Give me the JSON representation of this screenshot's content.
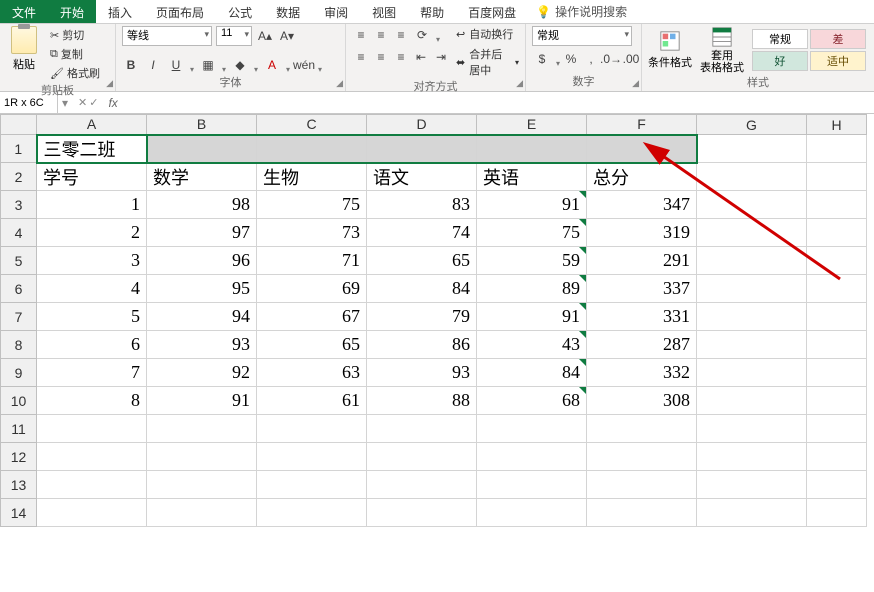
{
  "tabs": {
    "file": "文件",
    "home": "开始",
    "insert": "插入",
    "layout": "页面布局",
    "formulas": "公式",
    "data": "数据",
    "review": "审阅",
    "view": "视图",
    "help": "帮助",
    "baidu": "百度网盘",
    "search": "操作说明搜索"
  },
  "ribbon": {
    "clipboard": {
      "paste": "粘贴",
      "cut": "剪切",
      "copy": "复制",
      "format_painter": "格式刷",
      "label": "剪贴板"
    },
    "font": {
      "name": "等线",
      "size": "11",
      "label": "字体"
    },
    "alignment": {
      "wrap": "自动换行",
      "merge": "合并后居中",
      "label": "对齐方式"
    },
    "number": {
      "format": "常规",
      "label": "数字"
    },
    "styles": {
      "cond": "条件格式",
      "table": "套用\n表格格式",
      "normal": "常规",
      "bad": "差",
      "good": "好",
      "neutral": "适中",
      "label": "样式"
    }
  },
  "fx": {
    "name_box": "1R x 6C",
    "formula": ""
  },
  "columns": [
    "A",
    "B",
    "C",
    "D",
    "E",
    "F",
    "G",
    "H"
  ],
  "sheet": {
    "title": "三零二班",
    "headers": [
      "学号",
      "数学",
      "生物",
      "语文",
      "英语",
      "总分"
    ],
    "rows": [
      [
        1,
        98,
        75,
        83,
        91,
        347
      ],
      [
        2,
        97,
        73,
        74,
        75,
        319
      ],
      [
        3,
        96,
        71,
        65,
        59,
        291
      ],
      [
        4,
        95,
        69,
        84,
        89,
        337
      ],
      [
        5,
        94,
        67,
        79,
        91,
        331
      ],
      [
        6,
        93,
        65,
        86,
        43,
        287
      ],
      [
        7,
        92,
        63,
        93,
        84,
        332
      ],
      [
        8,
        91,
        61,
        88,
        68,
        308
      ]
    ]
  }
}
